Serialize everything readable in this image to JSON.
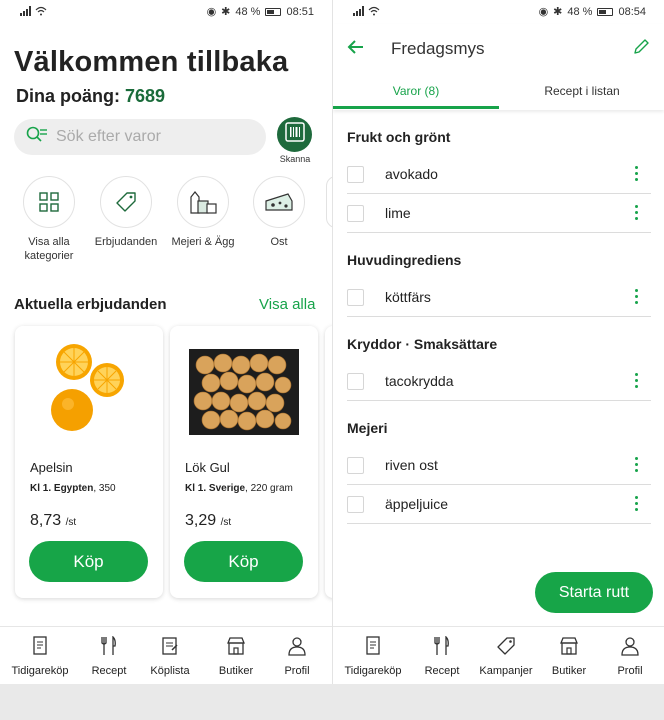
{
  "status_left": {
    "time": "08:51",
    "battery": "48 %"
  },
  "status_right": {
    "time": "08:54",
    "battery": "48 %"
  },
  "home": {
    "welcome": "Välkommen tillbaka",
    "points_label": "Dina poäng:",
    "points_value": "7689",
    "search_placeholder": "Sök efter varor",
    "scan_label": "Skanna",
    "categories": [
      {
        "label": "Visa alla kategorier",
        "icon": "grid-icon"
      },
      {
        "label": "Erbjudanden",
        "icon": "tag-icon"
      },
      {
        "label": "Mejeri & Ägg",
        "icon": "dairy-icon"
      },
      {
        "label": "Ost",
        "icon": "cheese-icon"
      }
    ],
    "offers_title": "Aktuella erbjudanden",
    "offers_link": "Visa alla",
    "products": [
      {
        "name": "Apelsin",
        "desc_bold": "Kl 1. Egypten",
        "desc": ", 350",
        "price": "8,73",
        "unit": "/st",
        "buy": "Köp",
        "image": "orange-image"
      },
      {
        "name": "Lök Gul",
        "desc_bold": "Kl 1. Sverige",
        "desc": ", 220 gram",
        "price": "3,29",
        "unit": "/st",
        "buy": "Köp",
        "image": "onion-image"
      }
    ]
  },
  "tabbar_left": [
    {
      "label": "Tidigareköp",
      "icon": "receipt-icon"
    },
    {
      "label": "Recept",
      "icon": "cutlery-icon"
    },
    {
      "label": "Köplista",
      "icon": "list-icon"
    },
    {
      "label": "Butiker",
      "icon": "store-icon"
    },
    {
      "label": "Profil",
      "icon": "profile-icon"
    }
  ],
  "list": {
    "title": "Fredagsmys",
    "tab_active": "Varor (8)",
    "tab_inactive": "Recept i listan",
    "groups": [
      {
        "title": "Frukt och grönt",
        "items": [
          "avokado",
          "lime"
        ]
      },
      {
        "title": "Huvudingrediens",
        "items": [
          "köttfärs"
        ]
      },
      {
        "title": "Kryddor · Smaksättare",
        "items": [
          "tacokrydda"
        ]
      },
      {
        "title": "Mejeri",
        "items": [
          "riven ost",
          "äppeljuice"
        ]
      }
    ],
    "start_button": "Starta rutt"
  },
  "tabbar_right": [
    {
      "label": "Tidigareköp",
      "icon": "receipt-icon"
    },
    {
      "label": "Recept",
      "icon": "cutlery-icon"
    },
    {
      "label": "Kampanjer",
      "icon": "tag-icon"
    },
    {
      "label": "Butiker",
      "icon": "store-icon"
    },
    {
      "label": "Profil",
      "icon": "profile-icon"
    }
  ],
  "colors": {
    "accent": "#17a548",
    "dark_green": "#1e6a3c",
    "points_green": "#1a6b3a"
  }
}
